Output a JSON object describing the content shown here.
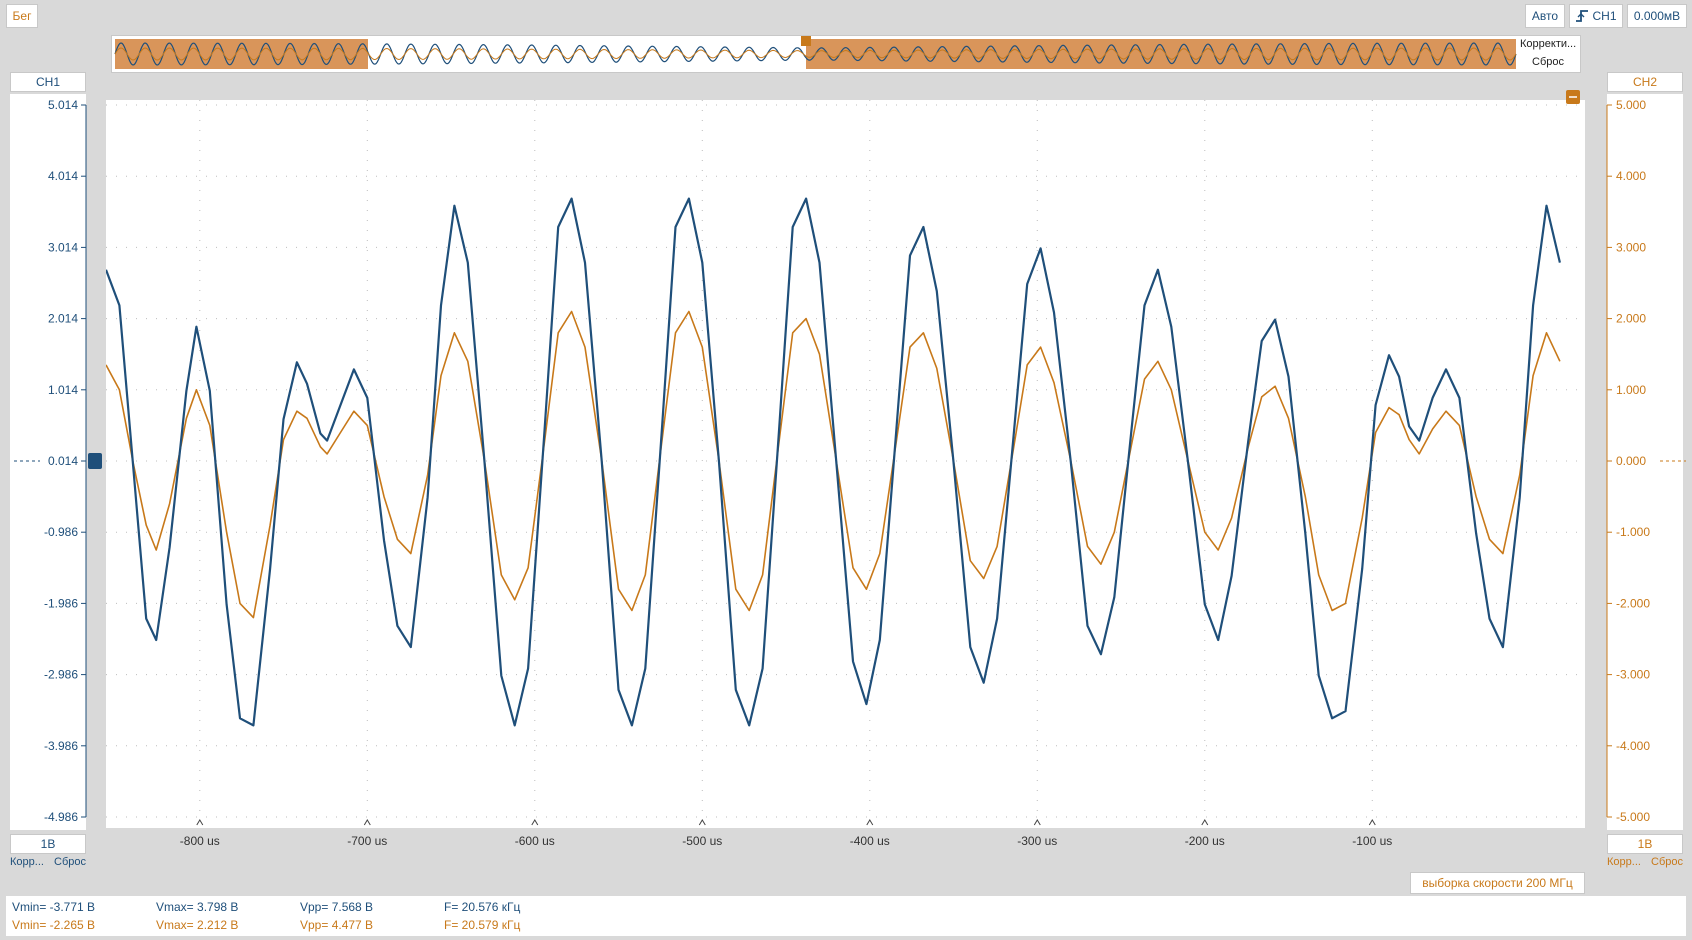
{
  "header": {
    "status": "Бег",
    "mode": "Авто",
    "trigger_source": "CH1",
    "trigger_level": "0.000мВ"
  },
  "overview": {
    "button1": "Корректи...",
    "button2": "Сброс"
  },
  "channels": {
    "ch1": {
      "name": "CH1",
      "scale": "1B",
      "btn_correct": "Корр...",
      "btn_reset": "Сброс",
      "color": "#1f4f7a"
    },
    "ch2": {
      "name": "CH2",
      "scale": "1B",
      "btn_correct": "Корр...",
      "btn_reset": "Сброс",
      "color": "#c8791a"
    }
  },
  "sample_rate": "выборка скорости 200 МГц",
  "measurements": {
    "ch1": {
      "vmin": "Vmin= -3.771 В",
      "vmax": "Vmax= 3.798 В",
      "vpp": "Vpp= 7.568 В",
      "freq": "F= 20.576 кГц"
    },
    "ch2": {
      "vmin": "Vmin= -2.265 В",
      "vmax": "Vmax= 2.212 В",
      "vpp": "Vpp= 4.477 В",
      "freq": "F= 20.579 кГц"
    }
  },
  "chart_data": {
    "type": "line",
    "x_unit": "us",
    "xlim": [
      -856,
      27
    ],
    "x_ticks": [
      -800,
      -700,
      -600,
      -500,
      -400,
      -300,
      -200,
      -100
    ],
    "x_tick_labels": [
      "-800 us",
      "-700 us",
      "-600 us",
      "-500 us",
      "-400 us",
      "-300 us",
      "-200 us",
      "-100 us"
    ],
    "left_axis": {
      "ylim": [
        -4.986,
        5.014
      ],
      "ticks": [
        "5.014",
        "4.014",
        "3.014",
        "2.014",
        "1.014",
        "0.014",
        "-0.986",
        "-1.986",
        "-2.986",
        "-3.986",
        "-4.986"
      ]
    },
    "right_axis": {
      "ylim": [
        -5.0,
        5.0
      ],
      "ticks": [
        "5.000",
        "4.000",
        "3.000",
        "2.000",
        "1.000",
        "0.000",
        "-1.000",
        "-2.000",
        "-3.000",
        "-4.000",
        "-5.000"
      ]
    },
    "grid": true,
    "series": [
      {
        "name": "CH1",
        "color": "#1f4f7a",
        "points": [
          [
            -856,
            2.7
          ],
          [
            -848,
            2.2
          ],
          [
            -840,
            0.0
          ],
          [
            -832,
            -2.2
          ],
          [
            -826,
            -2.5
          ],
          [
            -818,
            -1.2
          ],
          [
            -808,
            1.0
          ],
          [
            -802,
            1.9
          ],
          [
            -794,
            1.0
          ],
          [
            -784,
            -2.0
          ],
          [
            -776,
            -3.6
          ],
          [
            -768,
            -3.7
          ],
          [
            -758,
            -1.5
          ],
          [
            -750,
            0.6
          ],
          [
            -742,
            1.4
          ],
          [
            -736,
            1.1
          ],
          [
            -728,
            0.4
          ],
          [
            -724,
            0.3
          ],
          [
            -716,
            0.8
          ],
          [
            -708,
            1.3
          ],
          [
            -700,
            0.9
          ],
          [
            -690,
            -1.1
          ],
          [
            -682,
            -2.3
          ],
          [
            -674,
            -2.6
          ],
          [
            -664,
            -0.5
          ],
          [
            -656,
            2.2
          ],
          [
            -648,
            3.6
          ],
          [
            -640,
            2.8
          ],
          [
            -630,
            0.0
          ],
          [
            -620,
            -3.0
          ],
          [
            -612,
            -3.7
          ],
          [
            -604,
            -2.9
          ],
          [
            -594,
            0.5
          ],
          [
            -586,
            3.3
          ],
          [
            -578,
            3.7
          ],
          [
            -570,
            2.8
          ],
          [
            -560,
            0.0
          ],
          [
            -550,
            -3.2
          ],
          [
            -542,
            -3.7
          ],
          [
            -534,
            -2.9
          ],
          [
            -524,
            0.5
          ],
          [
            -516,
            3.3
          ],
          [
            -508,
            3.7
          ],
          [
            -500,
            2.8
          ],
          [
            -490,
            0.0
          ],
          [
            -480,
            -3.2
          ],
          [
            -472,
            -3.7
          ],
          [
            -464,
            -2.9
          ],
          [
            -454,
            0.5
          ],
          [
            -446,
            3.3
          ],
          [
            -438,
            3.7
          ],
          [
            -430,
            2.8
          ],
          [
            -420,
            0.0
          ],
          [
            -410,
            -2.8
          ],
          [
            -402,
            -3.4
          ],
          [
            -394,
            -2.5
          ],
          [
            -384,
            0.5
          ],
          [
            -376,
            2.9
          ],
          [
            -368,
            3.3
          ],
          [
            -360,
            2.4
          ],
          [
            -350,
            0.0
          ],
          [
            -340,
            -2.6
          ],
          [
            -332,
            -3.1
          ],
          [
            -324,
            -2.2
          ],
          [
            -314,
            0.4
          ],
          [
            -306,
            2.5
          ],
          [
            -298,
            3.0
          ],
          [
            -290,
            2.1
          ],
          [
            -280,
            0.0
          ],
          [
            -270,
            -2.3
          ],
          [
            -262,
            -2.7
          ],
          [
            -254,
            -1.9
          ],
          [
            -244,
            0.4
          ],
          [
            -236,
            2.2
          ],
          [
            -228,
            2.7
          ],
          [
            -220,
            1.9
          ],
          [
            -210,
            0.0
          ],
          [
            -200,
            -2.0
          ],
          [
            -192,
            -2.5
          ],
          [
            -184,
            -1.6
          ],
          [
            -174,
            0.3
          ],
          [
            -166,
            1.7
          ],
          [
            -158,
            2.0
          ],
          [
            -150,
            1.2
          ],
          [
            -140,
            -1.0
          ],
          [
            -132,
            -3.0
          ],
          [
            -124,
            -3.6
          ],
          [
            -116,
            -3.5
          ],
          [
            -106,
            -1.5
          ],
          [
            -98,
            0.8
          ],
          [
            -90,
            1.5
          ],
          [
            -84,
            1.2
          ],
          [
            -78,
            0.5
          ],
          [
            -72,
            0.3
          ],
          [
            -64,
            0.9
          ],
          [
            -56,
            1.3
          ],
          [
            -48,
            0.9
          ],
          [
            -38,
            -1.0
          ],
          [
            -30,
            -2.2
          ],
          [
            -22,
            -2.6
          ],
          [
            -12,
            -0.5
          ],
          [
            -4,
            2.2
          ],
          [
            4,
            3.6
          ],
          [
            12,
            2.8
          ]
        ]
      },
      {
        "name": "CH2",
        "color": "#c8791a",
        "points": [
          [
            -856,
            1.35
          ],
          [
            -848,
            1.0
          ],
          [
            -840,
            0.0
          ],
          [
            -832,
            -0.9
          ],
          [
            -826,
            -1.25
          ],
          [
            -818,
            -0.6
          ],
          [
            -808,
            0.6
          ],
          [
            -802,
            1.0
          ],
          [
            -794,
            0.5
          ],
          [
            -784,
            -1.0
          ],
          [
            -776,
            -2.0
          ],
          [
            -768,
            -2.2
          ],
          [
            -758,
            -0.9
          ],
          [
            -750,
            0.3
          ],
          [
            -742,
            0.7
          ],
          [
            -736,
            0.6
          ],
          [
            -728,
            0.2
          ],
          [
            -724,
            0.1
          ],
          [
            -716,
            0.4
          ],
          [
            -708,
            0.7
          ],
          [
            -700,
            0.5
          ],
          [
            -690,
            -0.5
          ],
          [
            -682,
            -1.1
          ],
          [
            -674,
            -1.3
          ],
          [
            -664,
            -0.2
          ],
          [
            -656,
            1.2
          ],
          [
            -648,
            1.8
          ],
          [
            -640,
            1.4
          ],
          [
            -630,
            0.0
          ],
          [
            -620,
            -1.6
          ],
          [
            -612,
            -1.95
          ],
          [
            -604,
            -1.5
          ],
          [
            -594,
            0.3
          ],
          [
            -586,
            1.8
          ],
          [
            -578,
            2.1
          ],
          [
            -570,
            1.6
          ],
          [
            -560,
            0.0
          ],
          [
            -550,
            -1.8
          ],
          [
            -542,
            -2.1
          ],
          [
            -534,
            -1.6
          ],
          [
            -524,
            0.3
          ],
          [
            -516,
            1.8
          ],
          [
            -508,
            2.1
          ],
          [
            -500,
            1.6
          ],
          [
            -490,
            0.0
          ],
          [
            -480,
            -1.8
          ],
          [
            -472,
            -2.1
          ],
          [
            -464,
            -1.6
          ],
          [
            -454,
            0.3
          ],
          [
            -446,
            1.8
          ],
          [
            -438,
            2.0
          ],
          [
            -430,
            1.5
          ],
          [
            -420,
            0.0
          ],
          [
            -410,
            -1.5
          ],
          [
            -402,
            -1.8
          ],
          [
            -394,
            -1.3
          ],
          [
            -384,
            0.3
          ],
          [
            -376,
            1.6
          ],
          [
            -368,
            1.8
          ],
          [
            -360,
            1.3
          ],
          [
            -350,
            0.0
          ],
          [
            -340,
            -1.4
          ],
          [
            -332,
            -1.65
          ],
          [
            -324,
            -1.2
          ],
          [
            -314,
            0.2
          ],
          [
            -306,
            1.35
          ],
          [
            -298,
            1.6
          ],
          [
            -290,
            1.1
          ],
          [
            -280,
            0.0
          ],
          [
            -270,
            -1.2
          ],
          [
            -262,
            -1.45
          ],
          [
            -254,
            -1.0
          ],
          [
            -244,
            0.2
          ],
          [
            -236,
            1.15
          ],
          [
            -228,
            1.4
          ],
          [
            -220,
            1.0
          ],
          [
            -210,
            0.0
          ],
          [
            -200,
            -1.0
          ],
          [
            -192,
            -1.25
          ],
          [
            -184,
            -0.8
          ],
          [
            -174,
            0.2
          ],
          [
            -166,
            0.9
          ],
          [
            -158,
            1.05
          ],
          [
            -150,
            0.6
          ],
          [
            -140,
            -0.5
          ],
          [
            -132,
            -1.6
          ],
          [
            -124,
            -2.1
          ],
          [
            -116,
            -2.0
          ],
          [
            -106,
            -0.8
          ],
          [
            -98,
            0.4
          ],
          [
            -90,
            0.75
          ],
          [
            -84,
            0.65
          ],
          [
            -78,
            0.3
          ],
          [
            -72,
            0.1
          ],
          [
            -64,
            0.45
          ],
          [
            -56,
            0.7
          ],
          [
            -48,
            0.5
          ],
          [
            -38,
            -0.5
          ],
          [
            -30,
            -1.1
          ],
          [
            -22,
            -1.3
          ],
          [
            -12,
            -0.2
          ],
          [
            -4,
            1.2
          ],
          [
            4,
            1.8
          ],
          [
            12,
            1.4
          ]
        ]
      }
    ]
  }
}
